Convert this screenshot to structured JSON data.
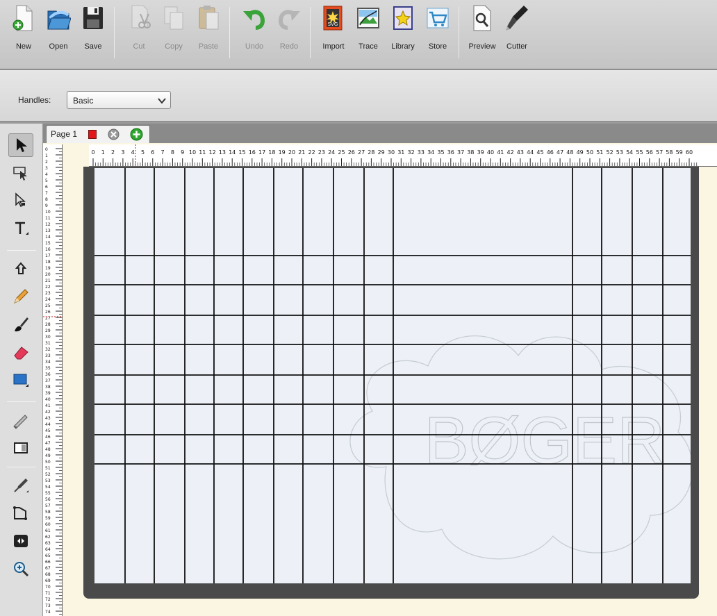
{
  "toolbar": {
    "new": "New",
    "open": "Open",
    "save": "Save",
    "cut": "Cut",
    "copy": "Copy",
    "paste": "Paste",
    "undo": "Undo",
    "redo": "Redo",
    "import": "Import",
    "trace": "Trace",
    "library": "Library",
    "store": "Store",
    "preview": "Preview",
    "cutter": "Cutter"
  },
  "handles": {
    "label": "Handles:",
    "value": "Basic"
  },
  "document": {
    "tab_label": "Page 1",
    "tab_color": "#e4141b"
  },
  "ruler": {
    "top_range": [
      0,
      60
    ],
    "left_range": [
      0,
      74
    ]
  },
  "watermark_text": "BØGER",
  "colors": {
    "mat": "#4a4a4a",
    "cut_area": "#edf1f7",
    "document_bg": "#fbf6e1",
    "toolbar_bg": "#d0d0d0"
  }
}
